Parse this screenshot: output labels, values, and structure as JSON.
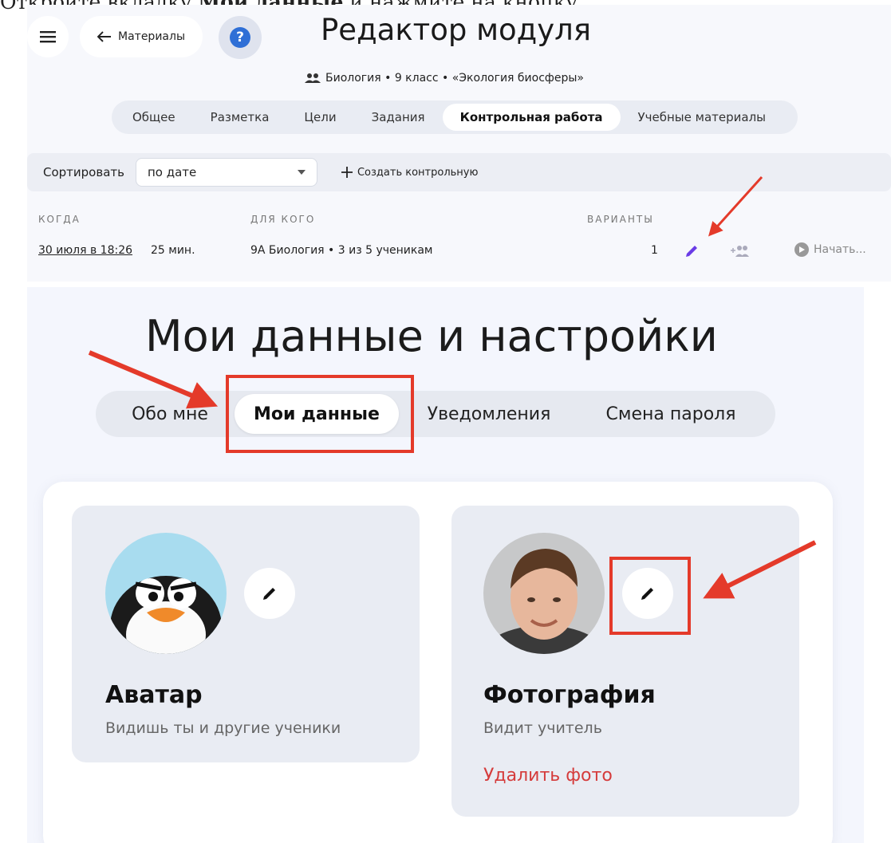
{
  "instruction": {
    "prefix": "Откройте вкладку ",
    "bold": "Мои данные",
    "suffix": " и нажмите на кнопку"
  },
  "top_panel": {
    "back_label": "Материалы",
    "help_label": "?",
    "title": "Редактор модуля",
    "subject": "Биология • 9 класс • «Экология биосферы»",
    "tabs": [
      "Общее",
      "Разметка",
      "Цели",
      "Задания",
      "Контрольная работа",
      "Учебные материалы"
    ],
    "active_tab": "Контрольная работа",
    "sort_label": "Сортировать",
    "sort_value": "по дате",
    "create_label": "Создать контрольную",
    "columns": {
      "when": "КОГДА",
      "for_whom": "ДЛЯ КОГО",
      "variants": "ВАРИАНТЫ"
    },
    "row": {
      "when": "30 июля в 18:26",
      "duration": "25 мин.",
      "for_whom": "9А Биология • 3 из 5 ученикам",
      "variants": "1",
      "start": "Начать..."
    }
  },
  "bottom_panel": {
    "title": "Мои данные и настройки",
    "tabs": [
      "Обо мне",
      "Мои данные",
      "Уведомления",
      "Смена пароля"
    ],
    "active_tab": "Мои данные",
    "avatar_card": {
      "title": "Аватар",
      "subtitle": "Видишь ты и другие ученики"
    },
    "photo_card": {
      "title": "Фотография",
      "subtitle": "Видит учитель",
      "delete_label": "Удалить фото"
    }
  },
  "colors": {
    "accent_red": "#e43a2a",
    "pencil_purple": "#6a3ce6",
    "help_blue": "#2f6fd6",
    "delete_red": "#d53b3b"
  }
}
